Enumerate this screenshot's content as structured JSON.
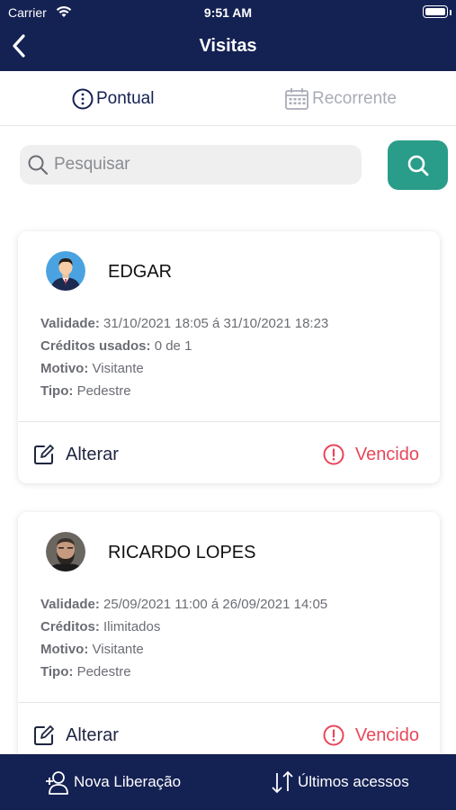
{
  "status_bar": {
    "carrier": "Carrier",
    "time": "9:51 AM"
  },
  "header": {
    "title": "Visitas"
  },
  "tabs": [
    {
      "label": "Pontual",
      "active": true
    },
    {
      "label": "Recorrente",
      "active": false
    }
  ],
  "search": {
    "placeholder": "Pesquisar",
    "value": ""
  },
  "visits": [
    {
      "name": "EDGAR",
      "fields": [
        {
          "label": "Validade:",
          "value": "31/10/2021 18:05 á 31/10/2021 18:23"
        },
        {
          "label": "Créditos usados:",
          "value": "0 de 1"
        },
        {
          "label": "Motivo:",
          "value": "Visitante"
        },
        {
          "label": "Tipo:",
          "value": "Pedestre"
        }
      ],
      "edit_label": "Alterar",
      "status_label": "Vencido"
    },
    {
      "name": "RICARDO LOPES",
      "fields": [
        {
          "label": "Validade:",
          "value": "25/09/2021 11:00 á 26/09/2021 14:05"
        },
        {
          "label": "Créditos:",
          "value": "Ilimitados"
        },
        {
          "label": "Motivo:",
          "value": "Visitante"
        },
        {
          "label": "Tipo:",
          "value": "Pedestre"
        }
      ],
      "edit_label": "Alterar",
      "status_label": "Vencido"
    }
  ],
  "bottom_bar": {
    "nova_label": "Nova Liberação",
    "ultimos_label": "Últimos acessos"
  },
  "colors": {
    "navy": "#142153",
    "teal": "#2a9d8a",
    "expired_red": "#e8465a"
  },
  "icons": [
    "back-chevron-icon",
    "info-circle-icon",
    "calendar-icon",
    "search-icon",
    "edit-icon",
    "alert-circle-icon",
    "add-user-icon",
    "sort-arrows-icon"
  ]
}
